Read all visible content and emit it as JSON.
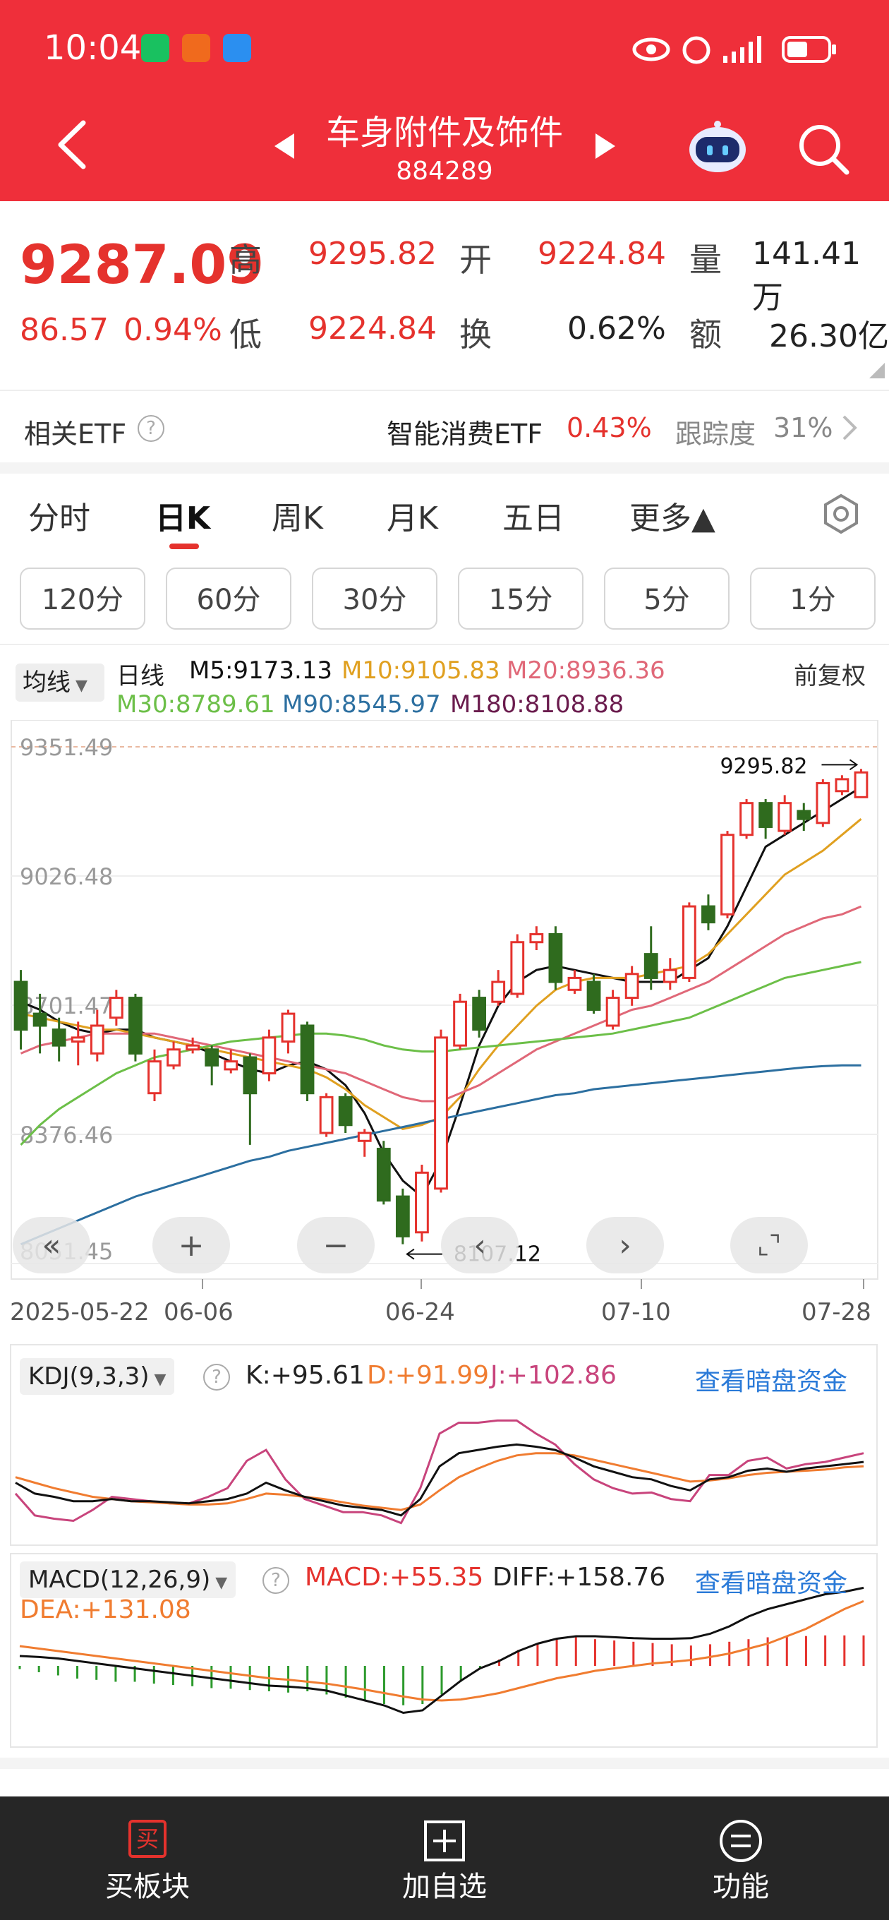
{
  "status_bar": {
    "time": "10:04"
  },
  "header": {
    "title": "车身附件及饰件",
    "code": "884289"
  },
  "quote": {
    "price": "9287.09",
    "change": "86.57",
    "change_pct": "0.94%",
    "labels": {
      "high": "高",
      "low": "低",
      "open": "开",
      "turnover": "换",
      "volume": "量",
      "amount": "额"
    },
    "high": "9295.82",
    "low": "9224.84",
    "open": "9224.84",
    "turnover_rate": "0.62%",
    "volume": "141.41万",
    "amount": "26.30亿"
  },
  "etf": {
    "label": "相关ETF",
    "name": "智能消费ETF",
    "pct": "0.43%",
    "tracking_label": "跟踪度",
    "tracking": "31%"
  },
  "period_tabs": [
    "分时",
    "日K",
    "周K",
    "月K",
    "五日",
    "更多▲"
  ],
  "minute_chips": [
    "120分",
    "60分",
    "30分",
    "15分",
    "5分",
    "1分"
  ],
  "ma_legend": {
    "selector": "均线",
    "daily": "日线",
    "adjust": "前复权",
    "m5": "M5:9173.13",
    "m10": "M10:9105.83",
    "m20": "M20:8936.36",
    "m30": "M30:8789.61",
    "m90": "M90:8545.97",
    "m180": "M180:8108.88"
  },
  "colors": {
    "header_red": "#ef2f3a",
    "up": "#e5322d",
    "down": "#2f6b1e",
    "m5": "#111111",
    "m10": "#e0a020",
    "m20": "#e06878",
    "m30": "#6cbf48",
    "m90": "#2c6fa0",
    "m180": "#6a1b4d",
    "link": "#2a7ad8"
  },
  "chart_data": {
    "type": "candlestick",
    "y_axis_labels": [
      "9351.49",
      "9026.48",
      "8701.47",
      "8376.46",
      "8051.45"
    ],
    "ylim": [
      8051.45,
      9351.49
    ],
    "x_axis_labels": [
      "2025-05-22",
      "06-06",
      "06-24",
      "07-10",
      "07-28"
    ],
    "annotations": {
      "max": "9295.82",
      "min": "8107.12"
    },
    "candles": [
      [
        8760,
        8640,
        8790,
        8590
      ],
      [
        8680,
        8650,
        8730,
        8580
      ],
      [
        8640,
        8600,
        8670,
        8560
      ],
      [
        8610,
        8620,
        8660,
        8550
      ],
      [
        8580,
        8650,
        8690,
        8560
      ],
      [
        8670,
        8720,
        8740,
        8650
      ],
      [
        8720,
        8580,
        8730,
        8560
      ],
      [
        8480,
        8560,
        8590,
        8460
      ],
      [
        8550,
        8590,
        8610,
        8540
      ],
      [
        8590,
        8600,
        8620,
        8580
      ],
      [
        8590,
        8550,
        8600,
        8500
      ],
      [
        8540,
        8560,
        8590,
        8530
      ],
      [
        8570,
        8480,
        8580,
        8350
      ],
      [
        8530,
        8620,
        8640,
        8510
      ],
      [
        8610,
        8680,
        8690,
        8580
      ],
      [
        8650,
        8480,
        8660,
        8460
      ],
      [
        8380,
        8470,
        8480,
        8370
      ],
      [
        8470,
        8400,
        8480,
        8380
      ],
      [
        8360,
        8380,
        8390,
        8320
      ],
      [
        8340,
        8210,
        8360,
        8200
      ],
      [
        8220,
        8120,
        8240,
        8100
      ],
      [
        8130,
        8280,
        8300,
        8107
      ],
      [
        8240,
        8620,
        8640,
        8230
      ],
      [
        8600,
        8710,
        8730,
        8590
      ],
      [
        8720,
        8640,
        8740,
        8620
      ],
      [
        8710,
        8760,
        8790,
        8700
      ],
      [
        8730,
        8860,
        8880,
        8720
      ],
      [
        8860,
        8880,
        8900,
        8840
      ],
      [
        8880,
        8760,
        8900,
        8740
      ],
      [
        8740,
        8770,
        8790,
        8730
      ],
      [
        8760,
        8690,
        8780,
        8680
      ],
      [
        8650,
        8720,
        8740,
        8640
      ],
      [
        8720,
        8780,
        8800,
        8700
      ],
      [
        8830,
        8770,
        8900,
        8740
      ],
      [
        8760,
        8790,
        8820,
        8740
      ],
      [
        8770,
        8950,
        8960,
        8760
      ],
      [
        8950,
        8910,
        8980,
        8890
      ],
      [
        8930,
        9130,
        9140,
        8920
      ],
      [
        9130,
        9210,
        9220,
        9120
      ],
      [
        9210,
        9150,
        9220,
        9120
      ],
      [
        9140,
        9210,
        9230,
        9130
      ],
      [
        9190,
        9170,
        9210,
        9140
      ],
      [
        9160,
        9260,
        9270,
        9150
      ],
      [
        9240,
        9270,
        9280,
        9230
      ],
      [
        9224.84,
        9287.09,
        9295.82,
        9224.84
      ]
    ],
    "ma_lines": {
      "m5": [
        8710,
        8690,
        8660,
        8640,
        8630,
        8640,
        8640,
        8620,
        8610,
        8600,
        8580,
        8560,
        8540,
        8530,
        8550,
        8560,
        8540,
        8500,
        8430,
        8330,
        8260,
        8220,
        8310,
        8450,
        8600,
        8700,
        8760,
        8790,
        8800,
        8790,
        8780,
        8770,
        8760,
        8760,
        8760,
        8790,
        8820,
        8900,
        9000,
        9100,
        9130,
        9160,
        9190,
        9220,
        9250
      ],
      "m10": [
        8680,
        8670,
        8660,
        8650,
        8640,
        8640,
        8630,
        8620,
        8610,
        8600,
        8590,
        8580,
        8570,
        8560,
        8550,
        8540,
        8520,
        8490,
        8450,
        8420,
        8390,
        8400,
        8420,
        8470,
        8540,
        8600,
        8650,
        8700,
        8740,
        8760,
        8770,
        8770,
        8770,
        8780,
        8790,
        8800,
        8830,
        8880,
        8930,
        8980,
        9030,
        9060,
        9090,
        9130,
        9170
      ],
      "m20": [
        8580,
        8600,
        8610,
        8620,
        8630,
        8630,
        8630,
        8630,
        8620,
        8610,
        8600,
        8590,
        8580,
        8570,
        8560,
        8550,
        8540,
        8530,
        8510,
        8490,
        8470,
        8460,
        8460,
        8480,
        8500,
        8530,
        8560,
        8590,
        8610,
        8630,
        8650,
        8670,
        8690,
        8700,
        8720,
        8740,
        8760,
        8790,
        8820,
        8850,
        8880,
        8900,
        8920,
        8930,
        8950
      ],
      "m30": [
        8350,
        8400,
        8440,
        8470,
        8500,
        8530,
        8550,
        8570,
        8580,
        8590,
        8600,
        8610,
        8615,
        8620,
        8625,
        8630,
        8630,
        8625,
        8615,
        8600,
        8590,
        8585,
        8585,
        8590,
        8595,
        8600,
        8605,
        8610,
        8615,
        8620,
        8625,
        8630,
        8640,
        8650,
        8660,
        8670,
        8690,
        8710,
        8730,
        8750,
        8770,
        8780,
        8790,
        8800,
        8810
      ],
      "m90": [
        8100,
        8120,
        8140,
        8160,
        8180,
        8200,
        8220,
        8235,
        8250,
        8265,
        8280,
        8295,
        8310,
        8320,
        8335,
        8345,
        8355,
        8365,
        8375,
        8385,
        8395,
        8405,
        8415,
        8425,
        8435,
        8445,
        8455,
        8465,
        8475,
        8480,
        8490,
        8495,
        8500,
        8505,
        8510,
        8515,
        8520,
        8525,
        8530,
        8535,
        8540,
        8545,
        8548,
        8550,
        8550
      ]
    }
  },
  "kdj": {
    "selector": "KDJ(9,3,3)",
    "k": "K:+95.61",
    "d": "D:+91.99",
    "j": "J:+102.86",
    "link": "查看暗盘资金",
    "k_series": [
      55,
      45,
      42,
      38,
      38,
      40,
      38,
      38,
      37,
      36,
      38,
      40,
      45,
      55,
      48,
      42,
      38,
      34,
      32,
      30,
      25,
      40,
      70,
      82,
      85,
      88,
      90,
      88,
      85,
      78,
      70,
      65,
      60,
      58,
      52,
      48,
      58,
      60,
      66,
      68,
      65,
      68,
      70,
      72,
      74
    ],
    "d_series": [
      60,
      55,
      50,
      46,
      42,
      40,
      38,
      37,
      36,
      35,
      35,
      36,
      40,
      45,
      44,
      42,
      40,
      37,
      34,
      32,
      30,
      35,
      48,
      60,
      68,
      75,
      80,
      82,
      82,
      80,
      76,
      72,
      68,
      64,
      60,
      56,
      57,
      59,
      62,
      64,
      65,
      66,
      67,
      69,
      70
    ],
    "j_series": [
      45,
      25,
      22,
      20,
      30,
      42,
      40,
      38,
      36,
      36,
      42,
      50,
      75,
      85,
      58,
      40,
      34,
      28,
      28,
      25,
      18,
      50,
      100,
      110,
      110,
      112,
      112,
      100,
      90,
      72,
      58,
      50,
      45,
      46,
      40,
      38,
      62,
      62,
      75,
      78,
      68,
      72,
      74,
      78,
      82
    ]
  },
  "macd": {
    "selector": "MACD(12,26,9)",
    "macd": "MACD:+55.35",
    "diff": "DIFF:+158.76",
    "dea": "DEA:+131.08",
    "link": "查看暗盘资金",
    "hist": [
      -5,
      -10,
      -15,
      -20,
      -22,
      -25,
      -25,
      -28,
      -30,
      -32,
      -35,
      -36,
      -38,
      -40,
      -42,
      -40,
      -45,
      -50,
      -55,
      -60,
      -62,
      -60,
      -45,
      -25,
      -5,
      10,
      25,
      35,
      42,
      45,
      42,
      40,
      38,
      36,
      34,
      32,
      34,
      38,
      42,
      45,
      46,
      47,
      48,
      48,
      48
    ],
    "diff_series": [
      20,
      18,
      15,
      10,
      5,
      0,
      -5,
      -10,
      -15,
      -20,
      -25,
      -30,
      -35,
      -40,
      -42,
      -45,
      -50,
      -60,
      -70,
      -80,
      -95,
      -90,
      -60,
      -30,
      -5,
      10,
      30,
      45,
      55,
      60,
      60,
      58,
      56,
      55,
      55,
      56,
      65,
      80,
      100,
      115,
      125,
      135,
      145,
      150,
      158
    ],
    "dea_series": [
      40,
      35,
      30,
      25,
      20,
      15,
      10,
      5,
      0,
      -5,
      -10,
      -15,
      -20,
      -25,
      -28,
      -32,
      -36,
      -42,
      -48,
      -55,
      -62,
      -68,
      -70,
      -68,
      -62,
      -55,
      -45,
      -35,
      -25,
      -18,
      -10,
      -5,
      0,
      5,
      8,
      12,
      18,
      25,
      35,
      45,
      60,
      75,
      95,
      115,
      131
    ]
  },
  "bottom_bar": {
    "buy": "买板块",
    "watch": "加自选",
    "func": "功能",
    "buy_glyph": "买"
  }
}
